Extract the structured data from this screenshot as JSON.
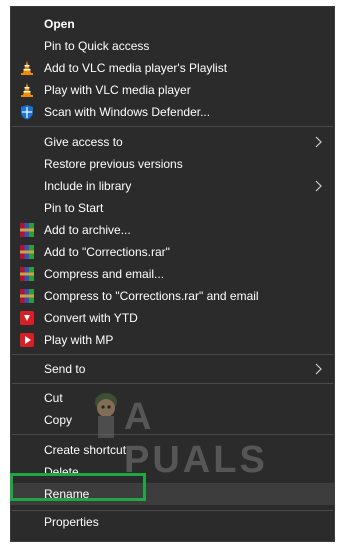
{
  "menu": {
    "items": {
      "open": "Open",
      "pin_quick_access": "Pin to Quick access",
      "vlc_playlist": "Add to VLC media player's Playlist",
      "vlc_play": "Play with VLC media player",
      "scan_defender": "Scan with Windows Defender...",
      "give_access": "Give access to",
      "restore_versions": "Restore previous versions",
      "include_library": "Include in library",
      "pin_start": "Pin to Start",
      "add_archive": "Add to archive...",
      "add_corrections_rar": "Add to \"Corrections.rar\"",
      "compress_email": "Compress and email...",
      "compress_corrections_email": "Compress to \"Corrections.rar\" and email",
      "convert_ytd": "Convert with YTD",
      "play_mp": "Play with MP",
      "send_to": "Send to",
      "cut": "Cut",
      "copy": "Copy",
      "create_shortcut": "Create shortcut",
      "delete": "Delete",
      "rename": "Rename",
      "properties": "Properties"
    }
  },
  "watermark": {
    "text": "A PUALS"
  },
  "colors": {
    "menu_bg": "#2b2b2b",
    "highlight": "#21a645",
    "vlc_orange": "#f28a00",
    "defender_blue": "#1a73d9",
    "winrar_red": "#b5122d"
  },
  "icons": {
    "vlc": "vlc-cone-icon",
    "defender": "windows-defender-shield-icon",
    "winrar": "winrar-books-icon",
    "ytd": "ytd-red-icon",
    "submenu": "chevron-right-icon"
  }
}
